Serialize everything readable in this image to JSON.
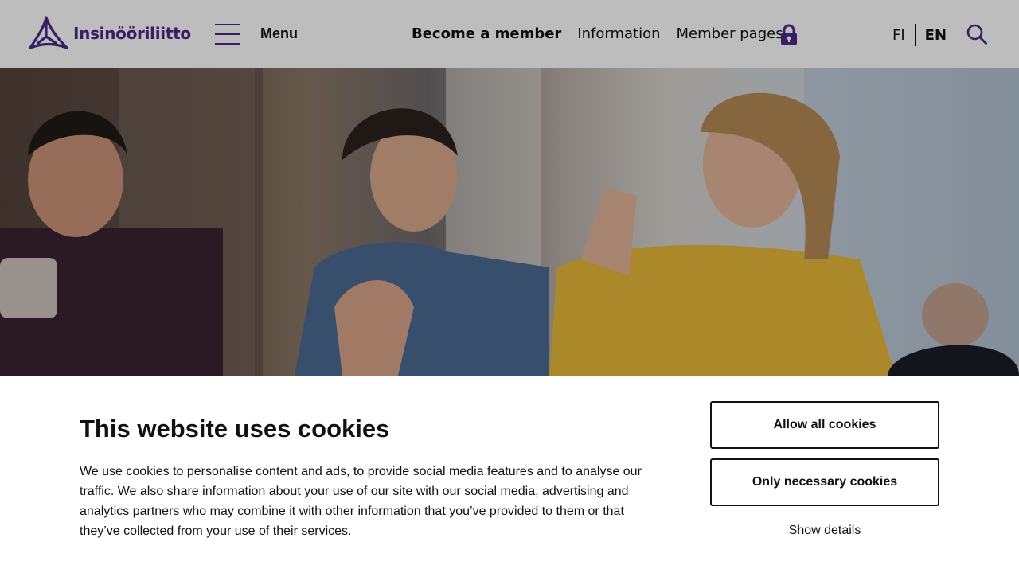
{
  "header": {
    "logo_text": "Insinööriliitto",
    "menu_label": "Menu",
    "nav": {
      "become_member": "Become a member",
      "information": "Information",
      "member_pages": "Member pages"
    },
    "lang": {
      "fi": "FI",
      "en": "EN",
      "active": "EN"
    },
    "icons": {
      "menu": "hamburger-icon",
      "lock": "lock-icon",
      "search": "search-icon"
    },
    "brand_color": "#4a2a85"
  },
  "hero": {
    "image_alt": ""
  },
  "cookie_banner": {
    "title": "This website uses cookies",
    "body": "We use cookies to personalise content and ads, to provide social media features and to analyse our traffic. We also share information about your use of our site with our social media, advertising and analytics partners who may combine it with other information that you’ve provided to them or that they’ve collected from your use of their services.",
    "allow_all": "Allow all cookies",
    "only_necessary": "Only necessary cookies",
    "show_details": "Show details"
  }
}
